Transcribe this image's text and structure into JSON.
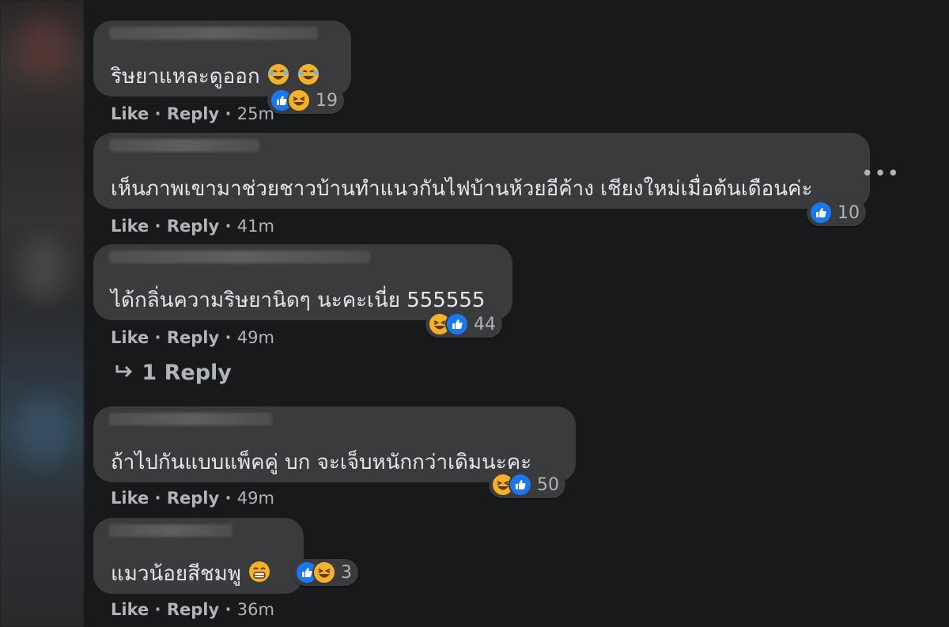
{
  "comments": [
    {
      "text": "ริษยาแหละดูออก",
      "inline_emoji": [
        "rofl-icon",
        "rofl-icon"
      ],
      "reactions": [
        "like-icon",
        "haha-icon"
      ],
      "reaction_count": "19",
      "like": "Like",
      "reply": "Reply",
      "time": "25m"
    },
    {
      "text": "เห็นภาพเขามาช่วยชาวบ้านทำแนวกันไฟบ้านห้วยอีค้าง เชียงใหม่เมื่อต้นเดือนค่ะ",
      "inline_emoji": [],
      "reactions": [
        "like-icon"
      ],
      "reaction_count": "10",
      "like": "Like",
      "reply": "Reply",
      "time": "41m"
    },
    {
      "text": "ได้กลิ่นความริษยานิดๆ นะคะเนี่ย 555555",
      "inline_emoji": [],
      "reactions": [
        "haha-icon",
        "like-icon"
      ],
      "reaction_count": "44",
      "like": "Like",
      "reply": "Reply",
      "time": "49m"
    },
    {
      "text": "ถ้าไปกันแบบแพ็คคู่ บก จะเจ็บหนักกว่าเดิมนะคะ",
      "inline_emoji": [],
      "reactions": [
        "haha-icon",
        "like-icon"
      ],
      "reaction_count": "50",
      "like": "Like",
      "reply": "Reply",
      "time": "49m"
    },
    {
      "text": "แมวน้อยสีชมพู",
      "inline_emoji": [
        "grin-icon"
      ],
      "reactions": [
        "like-icon",
        "haha-icon"
      ],
      "reaction_count": "3",
      "like": "Like",
      "reply": "Reply",
      "time": "36m"
    }
  ],
  "view_replies": "1 Reply",
  "more_options": "•••",
  "separator": "·",
  "colors": {
    "background": "#18191a",
    "bubble": "#3a3b3c",
    "text": "#e4e6eb",
    "secondary_text": "#b0b3b8",
    "like_blue": "#1877f2",
    "haha_yellow": "#f7b125"
  }
}
